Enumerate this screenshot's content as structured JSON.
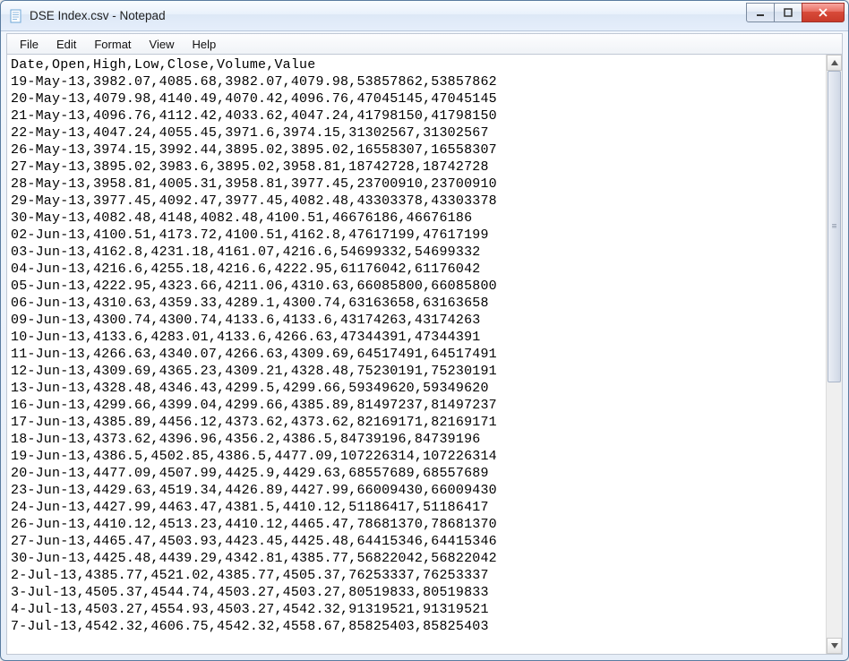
{
  "window": {
    "title": "DSE Index.csv - Notepad"
  },
  "menu": {
    "file": "File",
    "edit": "Edit",
    "format": "Format",
    "view": "View",
    "help": "Help"
  },
  "csv": {
    "header": [
      "Date",
      "Open",
      "High",
      "Low",
      "Close",
      "Volume",
      "Value"
    ],
    "rows": [
      [
        "19-May-13",
        "3982.07",
        "4085.68",
        "3982.07",
        "4079.98",
        "53857862",
        "53857862"
      ],
      [
        "20-May-13",
        "4079.98",
        "4140.49",
        "4070.42",
        "4096.76",
        "47045145",
        "47045145"
      ],
      [
        "21-May-13",
        "4096.76",
        "4112.42",
        "4033.62",
        "4047.24",
        "41798150",
        "41798150"
      ],
      [
        "22-May-13",
        "4047.24",
        "4055.45",
        "3971.6",
        "3974.15",
        "31302567",
        "31302567"
      ],
      [
        "26-May-13",
        "3974.15",
        "3992.44",
        "3895.02",
        "3895.02",
        "16558307",
        "16558307"
      ],
      [
        "27-May-13",
        "3895.02",
        "3983.6",
        "3895.02",
        "3958.81",
        "18742728",
        "18742728"
      ],
      [
        "28-May-13",
        "3958.81",
        "4005.31",
        "3958.81",
        "3977.45",
        "23700910",
        "23700910"
      ],
      [
        "29-May-13",
        "3977.45",
        "4092.47",
        "3977.45",
        "4082.48",
        "43303378",
        "43303378"
      ],
      [
        "30-May-13",
        "4082.48",
        "4148",
        "4082.48",
        "4100.51",
        "46676186",
        "46676186"
      ],
      [
        "02-Jun-13",
        "4100.51",
        "4173.72",
        "4100.51",
        "4162.8",
        "47617199",
        "47617199"
      ],
      [
        "03-Jun-13",
        "4162.8",
        "4231.18",
        "4161.07",
        "4216.6",
        "54699332",
        "54699332"
      ],
      [
        "04-Jun-13",
        "4216.6",
        "4255.18",
        "4216.6",
        "4222.95",
        "61176042",
        "61176042"
      ],
      [
        "05-Jun-13",
        "4222.95",
        "4323.66",
        "4211.06",
        "4310.63",
        "66085800",
        "66085800"
      ],
      [
        "06-Jun-13",
        "4310.63",
        "4359.33",
        "4289.1",
        "4300.74",
        "63163658",
        "63163658"
      ],
      [
        "09-Jun-13",
        "4300.74",
        "4300.74",
        "4133.6",
        "4133.6",
        "43174263",
        "43174263"
      ],
      [
        "10-Jun-13",
        "4133.6",
        "4283.01",
        "4133.6",
        "4266.63",
        "47344391",
        "47344391"
      ],
      [
        "11-Jun-13",
        "4266.63",
        "4340.07",
        "4266.63",
        "4309.69",
        "64517491",
        "64517491"
      ],
      [
        "12-Jun-13",
        "4309.69",
        "4365.23",
        "4309.21",
        "4328.48",
        "75230191",
        "75230191"
      ],
      [
        "13-Jun-13",
        "4328.48",
        "4346.43",
        "4299.5",
        "4299.66",
        "59349620",
        "59349620"
      ],
      [
        "16-Jun-13",
        "4299.66",
        "4399.04",
        "4299.66",
        "4385.89",
        "81497237",
        "81497237"
      ],
      [
        "17-Jun-13",
        "4385.89",
        "4456.12",
        "4373.62",
        "4373.62",
        "82169171",
        "82169171"
      ],
      [
        "18-Jun-13",
        "4373.62",
        "4396.96",
        "4356.2",
        "4386.5",
        "84739196",
        "84739196"
      ],
      [
        "19-Jun-13",
        "4386.5",
        "4502.85",
        "4386.5",
        "4477.09",
        "107226314",
        "107226314"
      ],
      [
        "20-Jun-13",
        "4477.09",
        "4507.99",
        "4425.9",
        "4429.63",
        "68557689",
        "68557689"
      ],
      [
        "23-Jun-13",
        "4429.63",
        "4519.34",
        "4426.89",
        "4427.99",
        "66009430",
        "66009430"
      ],
      [
        "24-Jun-13",
        "4427.99",
        "4463.47",
        "4381.5",
        "4410.12",
        "51186417",
        "51186417"
      ],
      [
        "26-Jun-13",
        "4410.12",
        "4513.23",
        "4410.12",
        "4465.47",
        "78681370",
        "78681370"
      ],
      [
        "27-Jun-13",
        "4465.47",
        "4503.93",
        "4423.45",
        "4425.48",
        "64415346",
        "64415346"
      ],
      [
        "30-Jun-13",
        "4425.48",
        "4439.29",
        "4342.81",
        "4385.77",
        "56822042",
        "56822042"
      ],
      [
        "2-Jul-13",
        "4385.77",
        "4521.02",
        "4385.77",
        "4505.37",
        "76253337",
        "76253337"
      ],
      [
        "3-Jul-13",
        "4505.37",
        "4544.74",
        "4503.27",
        "4503.27",
        "80519833",
        "80519833"
      ],
      [
        "4-Jul-13",
        "4503.27",
        "4554.93",
        "4503.27",
        "4542.32",
        "91319521",
        "91319521"
      ],
      [
        "7-Jul-13",
        "4542.32",
        "4606.75",
        "4542.32",
        "4558.67",
        "85825403",
        "85825403"
      ]
    ]
  }
}
